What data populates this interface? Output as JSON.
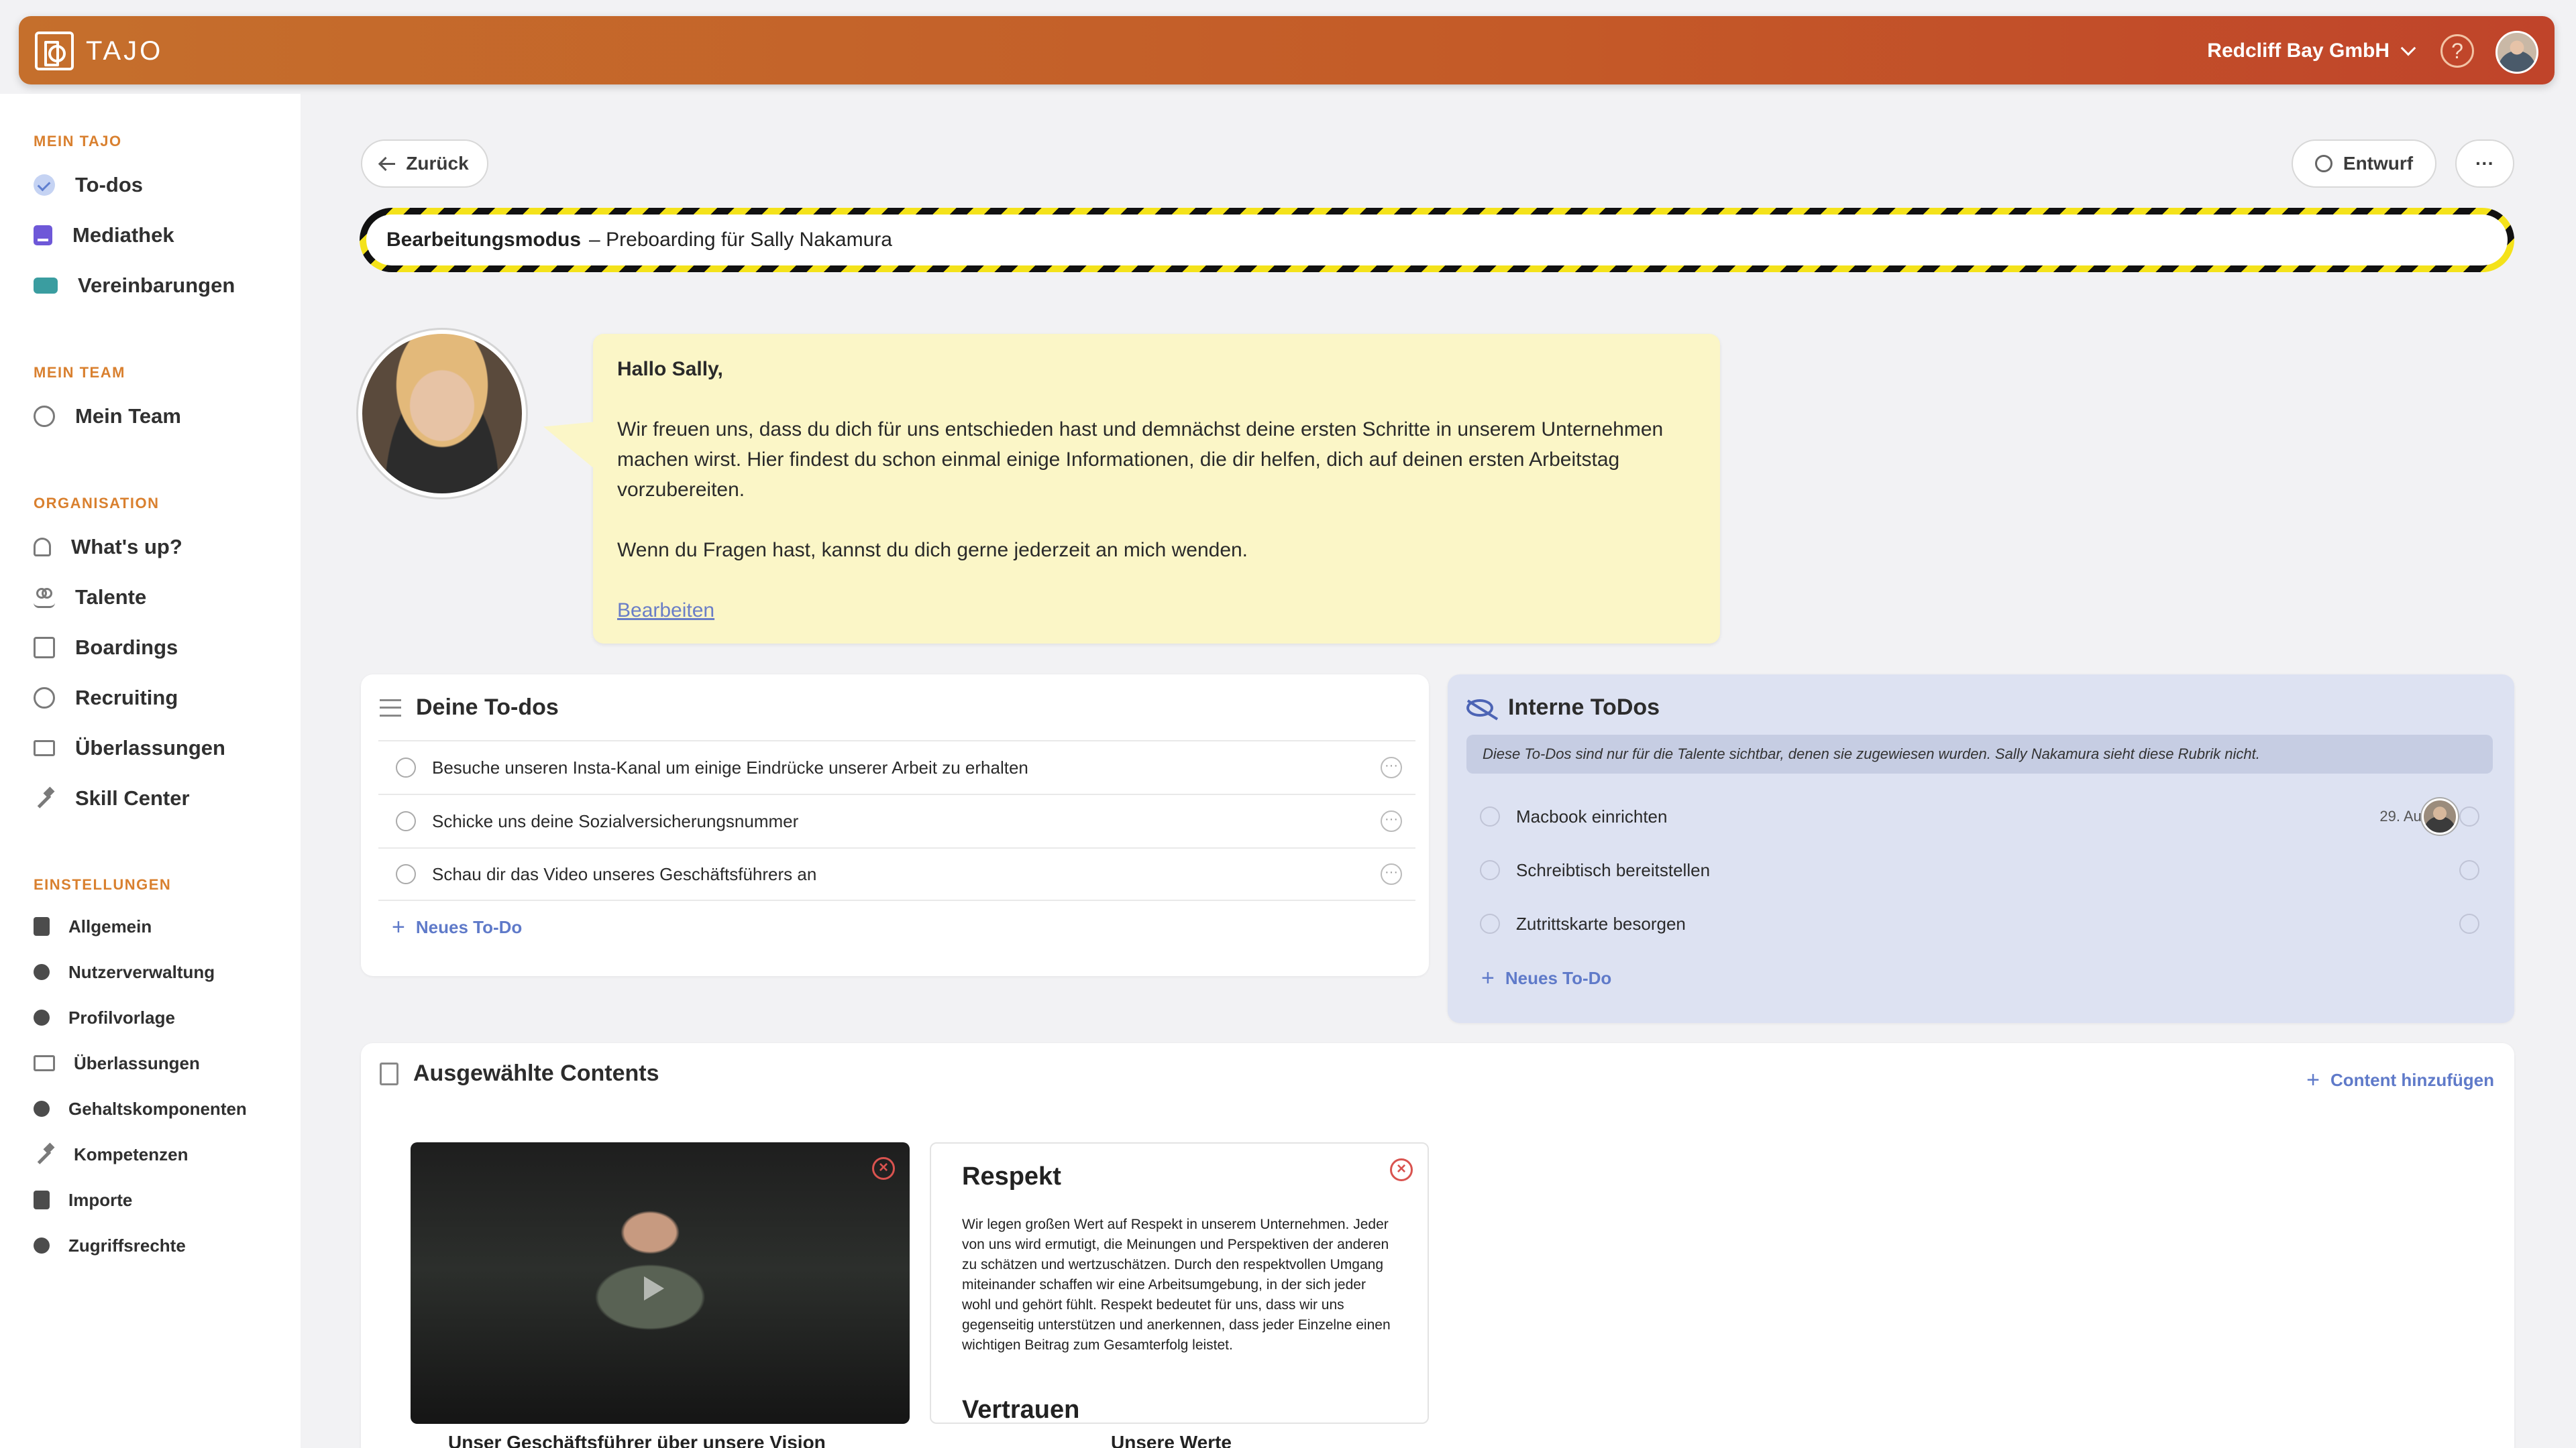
{
  "header": {
    "logo_text": "TAJO",
    "company": "Redcliff Bay GmbH",
    "help_symbol": "?"
  },
  "sidebar": {
    "sections": [
      {
        "title": "MEIN TAJO",
        "items": [
          {
            "label": "To-dos",
            "icon": "check-circle-icon"
          },
          {
            "label": "Mediathek",
            "icon": "media-icon"
          },
          {
            "label": "Vereinbarungen",
            "icon": "handshake-icon"
          }
        ]
      },
      {
        "title": "MEIN TEAM",
        "items": [
          {
            "label": "Mein Team",
            "icon": "smile-icon"
          }
        ]
      },
      {
        "title": "ORGANISATION",
        "items": [
          {
            "label": "What's up?",
            "icon": "bell-icon"
          },
          {
            "label": "Talente",
            "icon": "people-icon"
          },
          {
            "label": "Boardings",
            "icon": "clipboard-icon"
          },
          {
            "label": "Recruiting",
            "icon": "user-search-icon"
          },
          {
            "label": "Überlassungen",
            "icon": "devices-icon"
          },
          {
            "label": "Skill Center",
            "icon": "hammer-icon"
          }
        ]
      },
      {
        "title": "EINSTELLUNGEN",
        "items": [
          {
            "label": "Allgemein",
            "icon": "building-icon"
          },
          {
            "label": "Nutzerverwaltung",
            "icon": "person-icon"
          },
          {
            "label": "Profilvorlage",
            "icon": "profile-settings-icon"
          },
          {
            "label": "Überlassungen",
            "icon": "devices-icon"
          },
          {
            "label": "Gehaltskomponenten",
            "icon": "coins-icon"
          },
          {
            "label": "Kompetenzen",
            "icon": "hammer-icon"
          },
          {
            "label": "Importe",
            "icon": "import-icon"
          },
          {
            "label": "Zugriffsrechte",
            "icon": "key-icon"
          }
        ]
      }
    ]
  },
  "toolbar": {
    "back_label": "Zurück",
    "status_label": "Entwurf",
    "more_label": "···"
  },
  "editbar": {
    "mode": "Bearbeitungsmodus",
    "title": "– Preboarding für Sally Nakamura"
  },
  "welcome": {
    "greeting": "Hallo Sally,",
    "paragraph1": "Wir freuen uns, dass du dich für uns entschieden hast und demnächst deine ersten Schritte in unserem Unternehmen machen wirst. Hier findest du schon einmal einige Informationen, die dir helfen, dich auf deinen ersten Arbeitstag vorzubereiten.",
    "paragraph2": "Wenn du Fragen hast, kannst du dich gerne jederzeit an mich wenden.",
    "edit_link": "Bearbeiten"
  },
  "todos": {
    "title": "Deine To-dos",
    "items": [
      "Besuche unseren Insta-Kanal um einige Eindrücke unserer Arbeit zu erhalten",
      "Schicke uns deine Sozialversicherungsnummer",
      "Schau dir das Video unseres Geschäftsführers an"
    ],
    "add_label": "Neues To-Do"
  },
  "internal": {
    "title": "Interne ToDos",
    "note": "Diese To-Dos sind nur für die Talente sichtbar, denen sie zugewiesen wurden. Sally Nakamura sieht diese Rubrik nicht.",
    "items": [
      {
        "label": "Macbook einrichten",
        "date": "29. Aug"
      },
      {
        "label": "Schreibtisch bereitstellen"
      },
      {
        "label": "Zutrittskarte besorgen"
      }
    ],
    "add_label": "Neues To-Do"
  },
  "contents": {
    "title": "Ausgewählte Contents",
    "add_label": "Content hinzufügen",
    "tiles": [
      {
        "type": "video",
        "caption": "Unser Geschäftsführer über unsere Vision"
      },
      {
        "type": "text",
        "heading": "Respekt",
        "body": "Wir legen großen Wert auf Respekt in unserem Unternehmen. Jeder von uns wird ermutigt, die Meinungen und Perspektiven der anderen zu schätzen und wertzuschätzen. Durch den respektvollen Umgang miteinander schaffen wir eine Arbeitsumgebung, in der sich jeder wohl und gehört fühlt. Respekt bedeutet für uns, dass wir uns gegenseitig unterstützen und anerkennen, dass jeder Einzelne einen wichtigen Beitrag zum Gesamterfolg leistet.",
        "heading2": "Vertrauen",
        "caption": "Unsere Werte"
      }
    ]
  }
}
